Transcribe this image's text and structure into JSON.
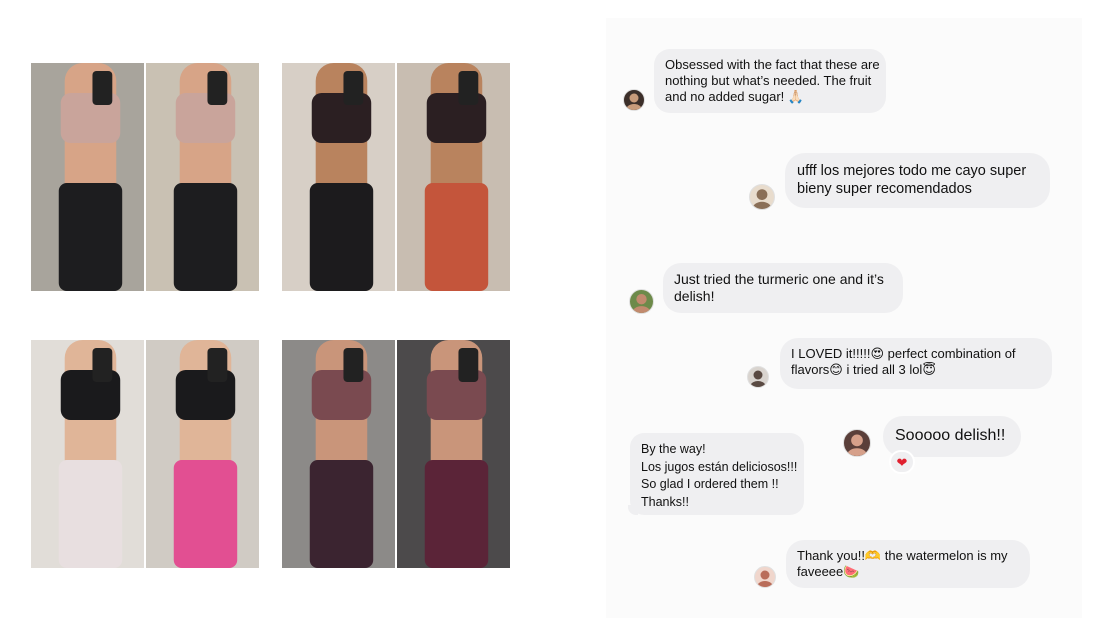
{
  "photos": [
    {
      "name": "before-after-photo-1",
      "left_bg": "#a8a49c",
      "right_bg": "#c9c1b3",
      "skin": "#d7a487",
      "top": "#c9a49b",
      "bottom": "#1d1d1f"
    },
    {
      "name": "before-after-photo-2",
      "left_bg": "#d7cfc6",
      "right_bg": "#c8bdb1",
      "skin": "#b9835e",
      "top": "#2b1f22",
      "bottom": "#1c1b1d",
      "bottom_right": "#c4553b"
    },
    {
      "name": "before-after-photo-3",
      "left_bg": "#e1ddd8",
      "right_bg": "#d0cbc4",
      "skin": "#e0b598",
      "top": "#1a1a1c",
      "bottom": "#e8dfe0",
      "bottom_right": "#e24f92"
    },
    {
      "name": "before-after-photo-4",
      "left_bg": "#8c8a88",
      "right_bg": "#4c4a4b",
      "skin": "#c9957a",
      "top": "#7a4a50",
      "bottom": "#3b2430",
      "bottom_right": "#5b2438"
    }
  ],
  "messages": [
    {
      "lines": [
        "Obsessed with the fact that these are",
        "nothing but what’s needed. The fruit",
        "and no added sugar! 🙏🏻"
      ]
    },
    {
      "lines": [
        "ufff los mejores todo me cayo super",
        "bieny super recomendados"
      ]
    },
    {
      "lines": [
        "Just tried the turmeric one and it’s",
        "delish!"
      ]
    },
    {
      "lines": [
        "I LOVED it!!!!!😍 perfect combination of",
        "flavors😊 i tried all 3 lol😇"
      ]
    },
    {
      "lines": [
        "Sooooo delish!!"
      ]
    },
    {
      "lines": [
        "By the way!",
        "Los jugos están deliciosos!!!",
        "So glad I ordered them !!",
        "Thanks!!"
      ]
    },
    {
      "lines": [
        "Thank you!!🫶 the watermelon is my",
        "faveeee🍉"
      ]
    }
  ],
  "reaction_icon": "red-heart-icon",
  "avatars": [
    {
      "name": "avatar-1",
      "bg": "#3c2f2a",
      "fg": "#c89b7b"
    },
    {
      "name": "avatar-2",
      "bg": "#e8dccd",
      "fg": "#8a6f57"
    },
    {
      "name": "avatar-3",
      "bg": "#6d8a4a",
      "fg": "#c28a6e"
    },
    {
      "name": "avatar-4",
      "bg": "#d9d4cf",
      "fg": "#5a4a42"
    },
    {
      "name": "avatar-5",
      "bg": "#5a3f3a",
      "fg": "#d6a08a"
    },
    {
      "name": "avatar-6",
      "bg": "#f0d6cc",
      "fg": "#b96d5a"
    }
  ]
}
